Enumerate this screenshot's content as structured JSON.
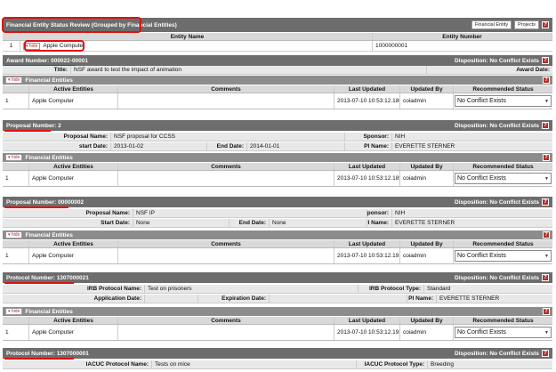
{
  "header": {
    "title": "Financial Entity Status Review (Grouped by Financial Entities)",
    "btn_financial_entity": "Financial Entity",
    "btn_projects": "Projects",
    "help": "?"
  },
  "entity_table": {
    "col_name": "Entity Name",
    "col_number": "Entity Number",
    "row_index": "1",
    "hide_label": "hide",
    "entity_name": "Apple Computer",
    "entity_number": "1000000001"
  },
  "common": {
    "hide": "hide",
    "financial_entities": "Financial Entities",
    "help": "?",
    "col_active": "Active Entities",
    "col_comments": "Comments",
    "col_updated": "Last Updated",
    "col_updatedby": "Updated By",
    "col_status": "Recommended Status",
    "disposition": "Disposition: No Conflict Exists",
    "select_value": "No Conflict Exists",
    "arrow": "▼"
  },
  "award": {
    "header": "Award Number: 000022-00001",
    "title_label": "Title:",
    "title_value": "NSF award to test the impact of animation",
    "award_date_label": "Award Date:",
    "row": {
      "idx": "1",
      "entity": "Apple Computer",
      "updated": "2013-07-10 10:53:12.186",
      "by": "coiadmin"
    }
  },
  "proposal2": {
    "header": "Proposal Number: 2",
    "name_label": "Proposal Name:",
    "name_value": "NSF proposal for CCSS",
    "sponsor_label": "Sponsor:",
    "sponsor_value": "NIH",
    "start_label": "start Date:",
    "start_value": "2013-01-02",
    "end_label": "End Date:",
    "end_value": "2014-01-01",
    "pi_label": "PI Name:",
    "pi_value": "EVERETTE STERNER",
    "row": {
      "idx": "1",
      "entity": "Apple Computer",
      "updated": "2013-07-10 10:53:12.189",
      "by": "coiadmin"
    }
  },
  "proposal3": {
    "header": "Proposal Number: 00000002",
    "name_label": "Proposal Name:",
    "name_value": "NSF IP",
    "sponsor_label": "Sponsor:",
    "sponsor_value": "NIH",
    "start_label": "Start Date:",
    "start_value": "None",
    "end_label": "End Date:",
    "end_value": "None",
    "pi_label": "PI Name:",
    "pi_value": "EVERETTE STERNER",
    "row": {
      "idx": "1",
      "entity": "Apple Computer",
      "updated": "2013-07-10 10:53:12.191",
      "by": "coiadmin"
    }
  },
  "protocol1": {
    "header": "Protocol Number: 1307000021",
    "irb_name_label": "IRB Protocol Name:",
    "irb_name_value": "Test on prisoners",
    "irb_type_label": "IRB Protocol Type:",
    "irb_type_value": "Standard",
    "app_label": "Application Date:",
    "exp_label": "Expiration Date:",
    "pi_label": "PI Name:",
    "pi_value": "EVERETTE STERNER",
    "row": {
      "idx": "1",
      "entity": "Apple Computer",
      "updated": "2013-07-10 10:53:12.193",
      "by": "coiadmin"
    }
  },
  "protocol2": {
    "header": "Protocol Number: 1307000001",
    "iacuc_name_label": "IACUC Protocol Name:",
    "iacuc_name_value": "Tests on mice",
    "iacuc_type_label": "IACUC Protocol Type:",
    "iacuc_type_value": "Breeding"
  }
}
